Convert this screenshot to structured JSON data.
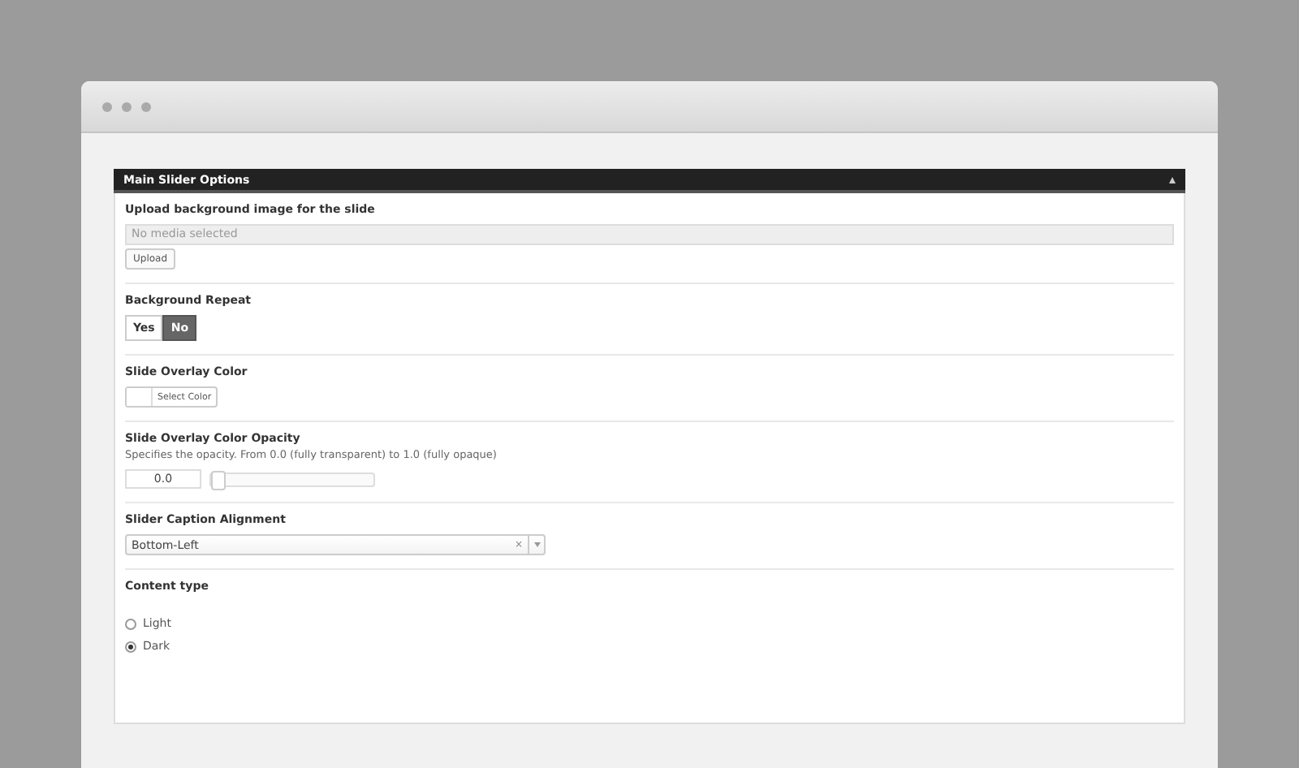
{
  "panel": {
    "title": "Main Slider Options",
    "expanded": true
  },
  "options": [
    {
      "kind": "upload",
      "label": "Upload background image for the slide",
      "placeholder": "No media selected",
      "button": "Upload"
    },
    {
      "kind": "toggle",
      "label": "Background Repeat",
      "choices": [
        {
          "label": "Yes",
          "selected": false
        },
        {
          "label": "No",
          "selected": true
        }
      ]
    },
    {
      "kind": "color",
      "label": "Slide Overlay Color",
      "button": "Select Color",
      "color": "#ffffff"
    },
    {
      "kind": "slider",
      "label": "Slide Overlay Color Opacity",
      "description": "Specifies the opacity. From 0.0 (fully transparent) to 1.0 (fully opaque)",
      "value": "0.0",
      "level": 0
    },
    {
      "kind": "select",
      "label": "Slider Caption Alignment",
      "value": "Bottom-Left",
      "clear": "×"
    },
    {
      "kind": "radio",
      "label": "Content type",
      "choices": [
        {
          "label": "Light",
          "selected": false
        },
        {
          "label": "Dark",
          "selected": true
        }
      ]
    }
  ]
}
